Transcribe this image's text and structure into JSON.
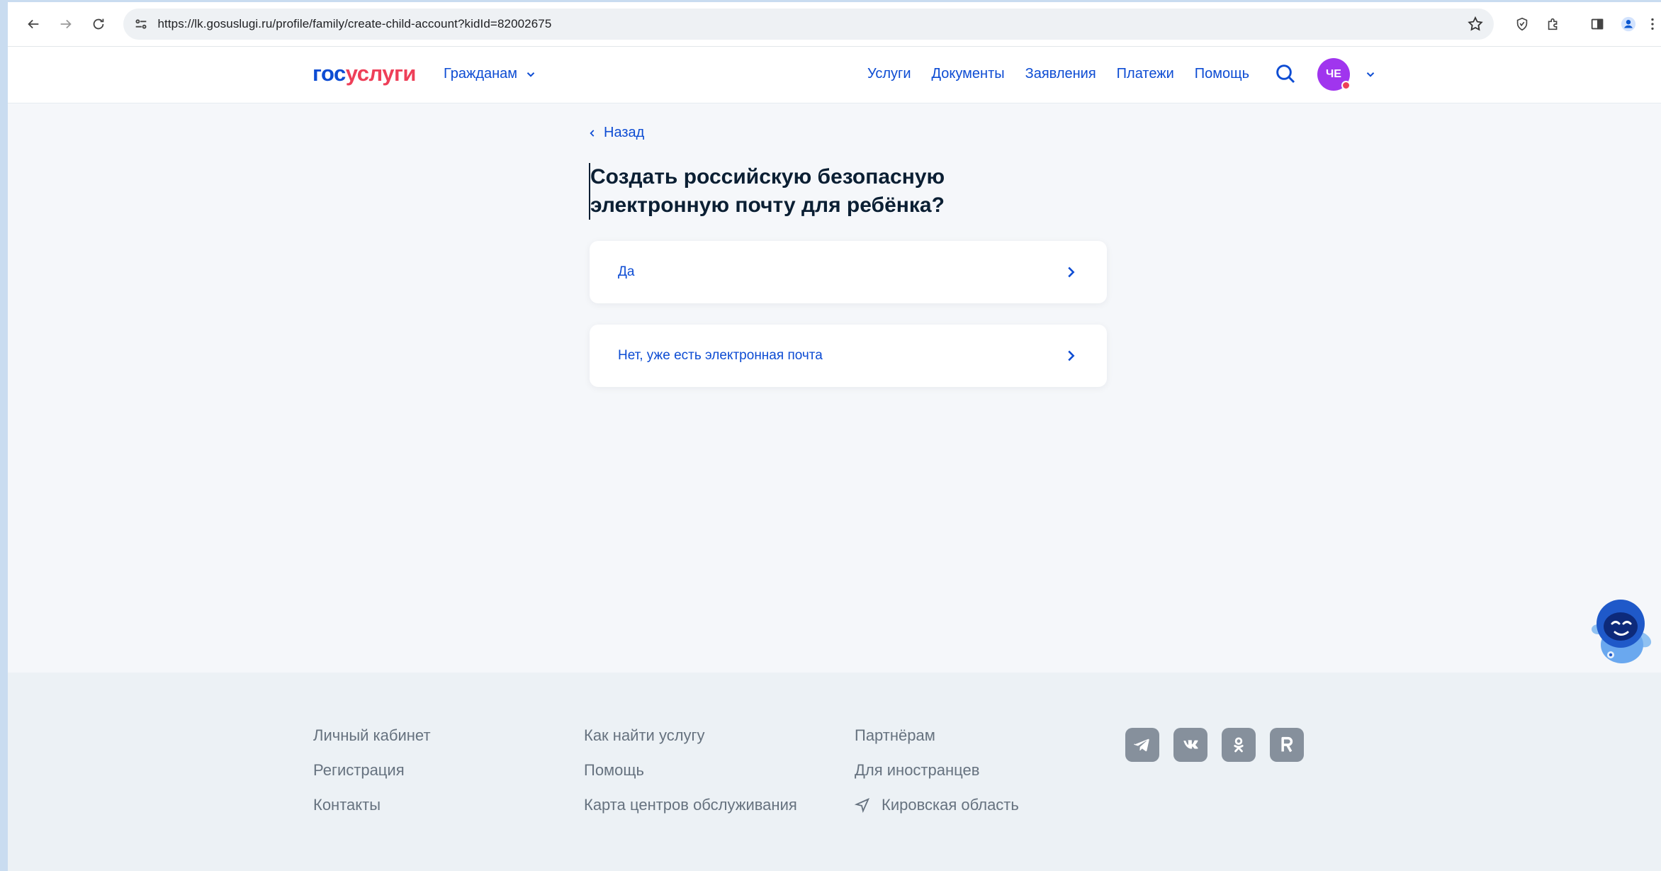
{
  "browser": {
    "url": "https://lk.gosuslugi.ru/profile/family/create-child-account?kidId=82002675"
  },
  "header": {
    "logo_part1": "гос",
    "logo_part2": "услуги",
    "audience_label": "Гражданам",
    "nav": [
      "Услуги",
      "Документы",
      "Заявления",
      "Платежи",
      "Помощь"
    ],
    "avatar_initials": "ЧЕ"
  },
  "main": {
    "back_label": "Назад",
    "title": "Создать российскую безопасную электронную почту для ребёнка?",
    "options": [
      {
        "label": "Да"
      },
      {
        "label": "Нет, уже есть электронная почта"
      }
    ]
  },
  "footer": {
    "col1": [
      "Личный кабинет",
      "Регистрация",
      "Контакты"
    ],
    "col2": [
      "Как найти услугу",
      "Помощь",
      "Карта центров обслуживания"
    ],
    "col3": [
      "Партнёрам",
      "Для иностранцев"
    ],
    "region": "Кировская область",
    "socials": [
      "telegram-icon",
      "vk-icon",
      "odnoklassniki-icon",
      "rutube-icon"
    ]
  },
  "colors": {
    "brand_blue": "#0d4cd3",
    "brand_red": "#ee3f58",
    "avatar_purple": "#a035ee",
    "page_bg": "#f5f7fa",
    "footer_bg": "#ecf1f5"
  }
}
